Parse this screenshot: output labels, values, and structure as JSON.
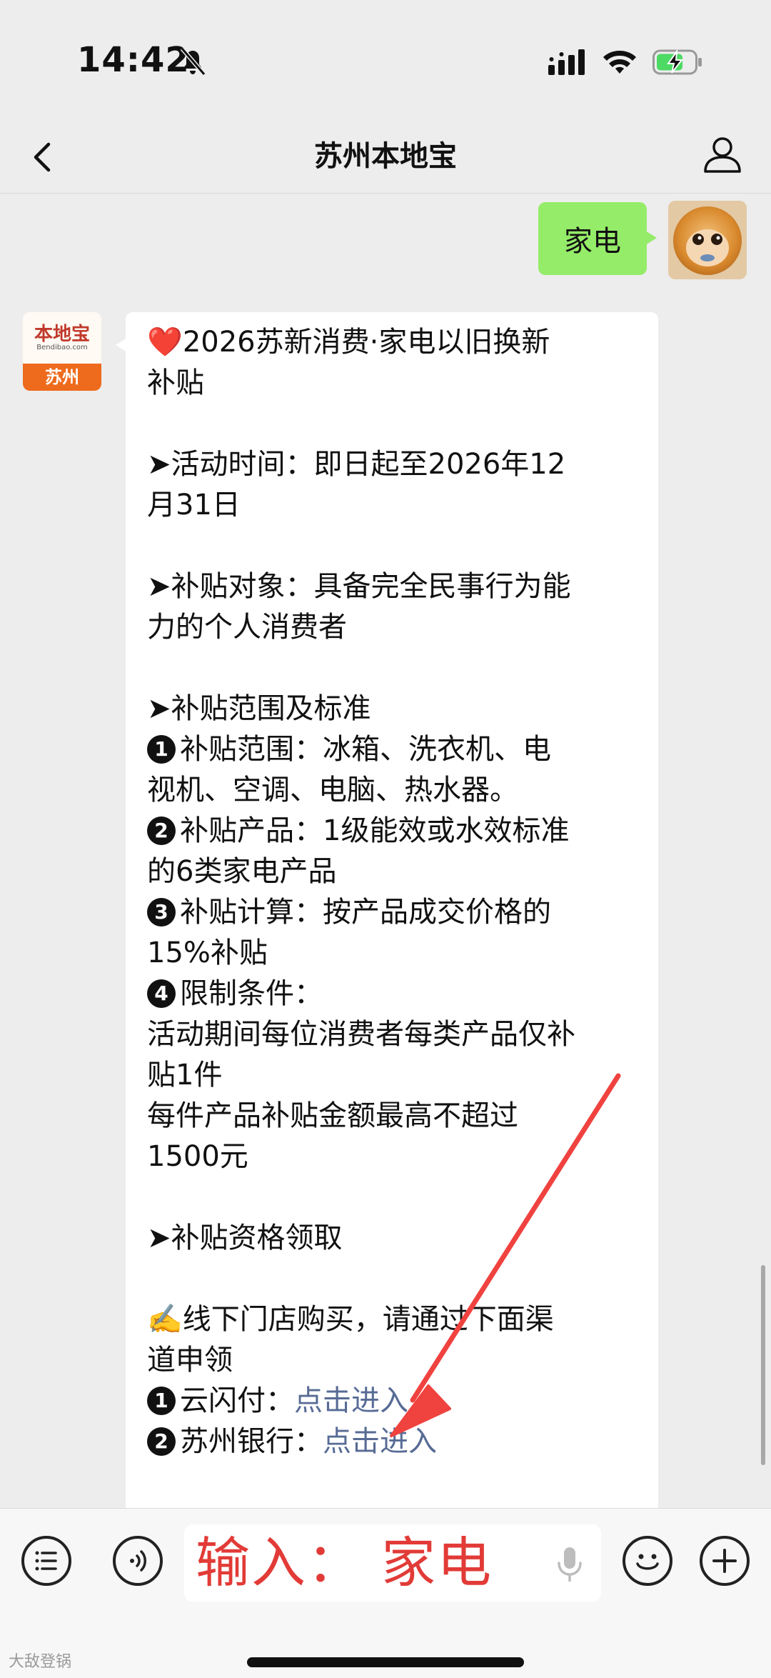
{
  "status_bar": {
    "time": "14:42"
  },
  "nav": {
    "title": "苏州本地宝"
  },
  "chat": {
    "outgoing_message": "家电",
    "bot_avatar": {
      "logo_cn": "本地宝",
      "logo_en": "Bendibao.com",
      "city": "苏州"
    },
    "incoming_lines": [
      {
        "heart": "❤️",
        "text": "2026苏新消费·家电以旧换新"
      },
      {
        "text": "补贴"
      },
      {
        "text": ""
      },
      {
        "text": "➤活动时间：即日起至2026年12"
      },
      {
        "text": "月31日"
      },
      {
        "text": ""
      },
      {
        "text": "➤补贴对象：具备完全民事行为能"
      },
      {
        "text": "力的个人消费者"
      },
      {
        "text": ""
      },
      {
        "text": "➤补贴范围及标准"
      },
      {
        "num": "1",
        "text": "补贴范围：冰箱、洗衣机、电"
      },
      {
        "text": "视机、空调、电脑、热水器。"
      },
      {
        "num": "2",
        "text": "补贴产品：1级能效或水效标准"
      },
      {
        "text": "的6类家电产品"
      },
      {
        "num": "3",
        "text": "补贴计算：按产品成交价格的"
      },
      {
        "text": "15%补贴"
      },
      {
        "num": "4",
        "text": "限制条件："
      },
      {
        "text": "活动期间每位消费者每类产品仅补"
      },
      {
        "text": "贴1件"
      },
      {
        "text": "每件产品补贴金额最高不超过"
      },
      {
        "text": "1500元"
      },
      {
        "text": ""
      },
      {
        "text": "➤补贴资格领取"
      },
      {
        "text": ""
      },
      {
        "text": "✍️线下门店购买，请通过下面渠"
      },
      {
        "text": "道申领"
      },
      {
        "num": "1",
        "text": "云闪付：",
        "link": "点击进入"
      },
      {
        "num": "2",
        "text": "苏州银行：",
        "link": "点击进入"
      }
    ]
  },
  "input_bar": {
    "input_value": "输入：  家电",
    "watermark": "大敌登锅"
  },
  "colors": {
    "background": "#ededed",
    "outgoing_bubble": "#95ec69",
    "link": "#576b95",
    "annotation_red": "#e23b37"
  },
  "icons": [
    "bell-slash-icon",
    "cellular-icon",
    "wifi-icon",
    "battery-charging-icon",
    "back-chevron-icon",
    "profile-icon",
    "menu-list-icon",
    "voice-icon",
    "mic-icon",
    "emoji-icon",
    "plus-icon"
  ]
}
